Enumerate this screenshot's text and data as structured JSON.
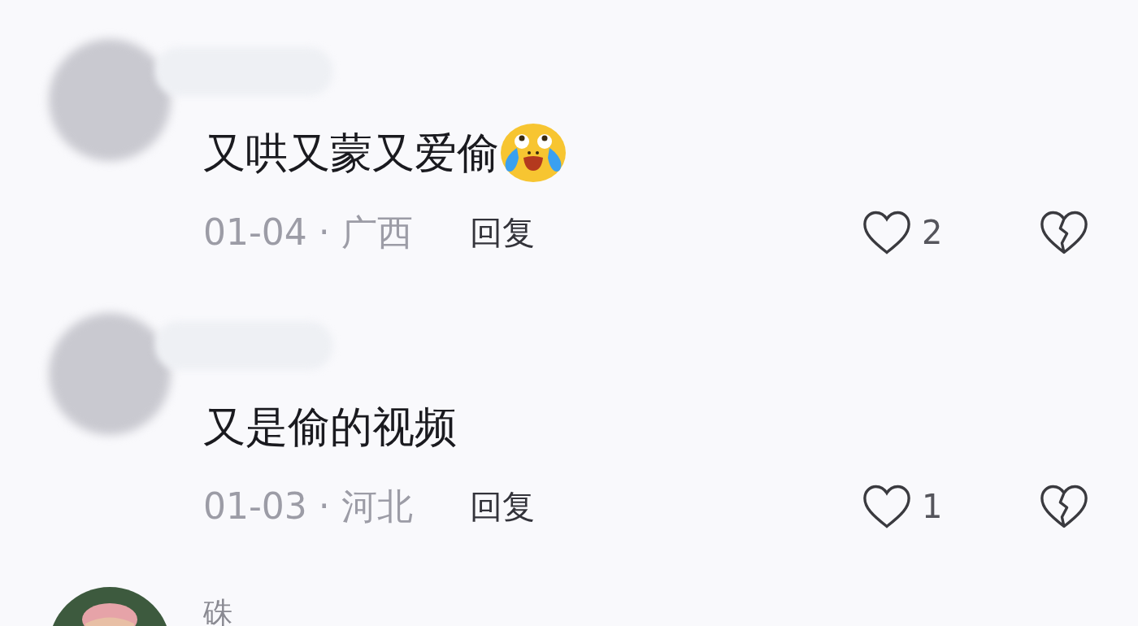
{
  "comments": [
    {
      "kind": "blurred",
      "text": "又哄又蒙又爱偷",
      "emoji": true,
      "date": "01-04",
      "separator": "·",
      "location": "广西",
      "reply": "回复",
      "likes": "2"
    },
    {
      "kind": "blurred",
      "text": "又是偷的视频",
      "emoji": false,
      "date": "01-03",
      "separator": "·",
      "location": "河北",
      "reply": "回复",
      "likes": "1"
    },
    {
      "kind": "figure",
      "name": "硃"
    }
  ]
}
